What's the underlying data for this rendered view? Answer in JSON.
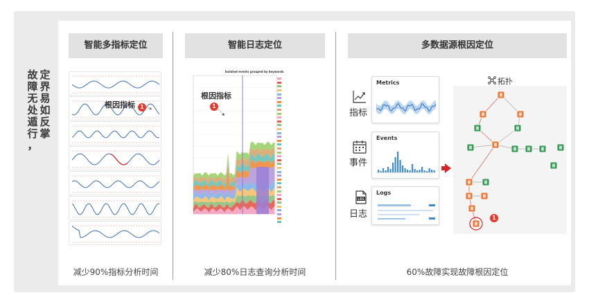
{
  "side_slogan": {
    "part1": [
      "故",
      "障",
      "无",
      "处",
      "遁",
      "行",
      "，"
    ],
    "part2": [
      "定",
      "界",
      "易",
      "如",
      "反",
      "掌"
    ]
  },
  "panels": [
    {
      "title": "智能多指标定位",
      "footer": "减少90%指标分析时间",
      "annotation": "根因指标",
      "badge": "1"
    },
    {
      "title": "智能日志定位",
      "footer": "减少80%日志查询分析时间",
      "annotation": "根因指标",
      "badge": "1",
      "chart_title": "Isolated events grouped by keywords"
    },
    {
      "title": "多数据源根因定位",
      "footer": "60%故障实现故障根因定位",
      "badge": "1",
      "topology_label": "拓扑",
      "sources": [
        {
          "label": "指标",
          "card_title": "Metrics",
          "icon": "metrics-chart-icon"
        },
        {
          "label": "事件",
          "card_title": "Events",
          "icon": "calendar-icon"
        },
        {
          "label": "日志",
          "card_title": "Logs",
          "icon": "log-file-icon"
        }
      ]
    }
  ],
  "colors": {
    "accent_red": "#d8252a",
    "line_blue": "#3b6fb5",
    "header_bg": "#e2e2e2",
    "node_orange": "#e8793a",
    "node_green": "#3a9a5a"
  }
}
